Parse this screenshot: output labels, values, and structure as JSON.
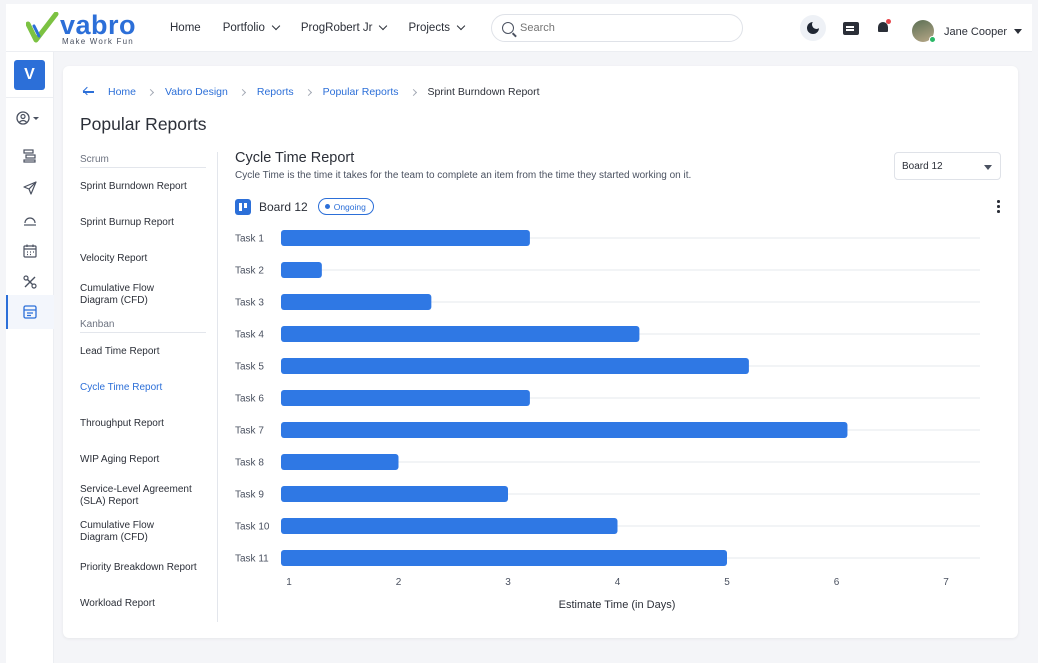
{
  "brand": {
    "name": "vabro",
    "tagline": "Make Work Fun"
  },
  "nav": [
    {
      "label": "Home",
      "has_menu": false
    },
    {
      "label": "Portfolio",
      "has_menu": true
    },
    {
      "label": "ProgRobert Jr",
      "has_menu": true
    },
    {
      "label": "Projects",
      "has_menu": true
    }
  ],
  "search": {
    "placeholder": "Search"
  },
  "user": {
    "name": "Jane Cooper"
  },
  "sidebar": {
    "workspace_initial": "V"
  },
  "breadcrumbs": [
    "Home",
    "Vabro Design",
    "Reports",
    "Popular Reports",
    "Sprint Burndown Report"
  ],
  "page_title": "Popular Reports",
  "report_nav": {
    "sections": [
      {
        "title": "Scrum",
        "items": [
          "Sprint Burndown Report",
          "Sprint Burnup Report",
          "Velocity Report",
          "Cumulative Flow Diagram (CFD)"
        ]
      },
      {
        "title": "Kanban",
        "items": [
          "Lead Time Report",
          "Cycle Time Report",
          "Throughput Report",
          "WIP Aging Report",
          "Service-Level Agreement (SLA) Report",
          "Cumulative Flow Diagram (CFD)",
          "Priority Breakdown Report",
          "Workload Report"
        ]
      }
    ],
    "active_item": "Cycle Time Report"
  },
  "report": {
    "title": "Cycle Time Report",
    "description": "Cycle Time is the time it takes for the team to complete an item from the time they started working on it.",
    "board_select": "Board 12",
    "board_name": "Board 12",
    "status_badge": "Ongoing"
  },
  "chart_data": {
    "type": "bar",
    "orientation": "horizontal",
    "categories": [
      "Task 1",
      "Task 2",
      "Task 3",
      "Task 4",
      "Task 5",
      "Task 6",
      "Task 7",
      "Task 8",
      "Task 9",
      "Task 10",
      "Task 11"
    ],
    "values": [
      3.2,
      1.3,
      2.3,
      4.2,
      5.2,
      3.2,
      6.1,
      2.0,
      3.0,
      4.0,
      5.0
    ],
    "xlabel": "Estimate Time (in Days)",
    "xticks": [
      1,
      2,
      3,
      4,
      5,
      6,
      7
    ],
    "xlim": [
      0.9,
      7.3
    ],
    "grid": true,
    "bar_color": "#2f78e4"
  },
  "colors": {
    "accent": "#2c6fd8",
    "bar": "#2f78e4"
  }
}
